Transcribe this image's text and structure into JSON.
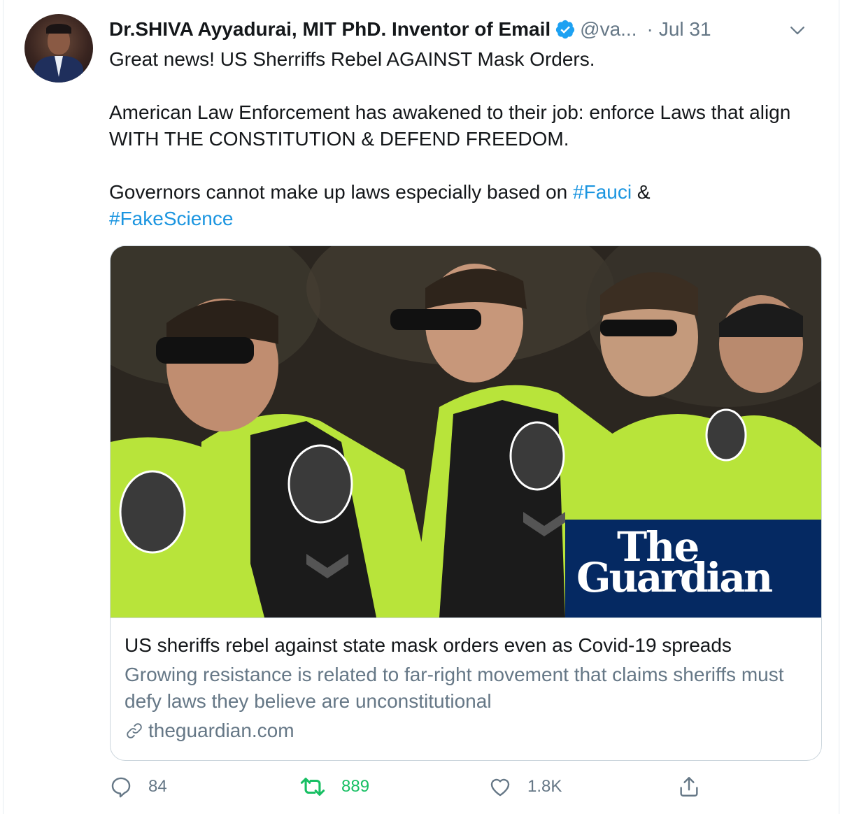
{
  "author": {
    "name": "Dr.SHIVA Ayyadurai, MIT PhD. Inventor of Email",
    "handle": "@va...",
    "separator": "·",
    "date": "Jul 31",
    "verified": true
  },
  "tweet": {
    "paragraphs": [
      "Great news!  US Sherriffs Rebel AGAINST Mask Orders.",
      "American Law Enforcement has awakened to their job: enforce Laws that align WITH THE CONSTITUTION & DEFEND FREEDOM."
    ],
    "last_paragraph": {
      "prefix": "Governors cannot make up laws especially based on ",
      "hashtag1": "#Fauci",
      "middle": " &",
      "hashtag2": "#FakeScience"
    }
  },
  "card": {
    "image_alt": "Sheriff deputies in high-visibility vests",
    "brand_line1": "The",
    "brand_line2": "Guardian",
    "title": "US sheriffs rebel against state mask orders even as Covid-19 spreads",
    "description": "Growing resistance is related to far-right movement that claims sheriffs must defy laws they believe are unconstitutional",
    "domain": "theguardian.com"
  },
  "actions": {
    "replies": "84",
    "retweets": "889",
    "likes": "1.8K"
  },
  "colors": {
    "link": "#1b95e0",
    "retweet_active": "#17bf63",
    "muted": "#657786",
    "verified": "#1da1f2",
    "guardian_blue": "#052962"
  }
}
